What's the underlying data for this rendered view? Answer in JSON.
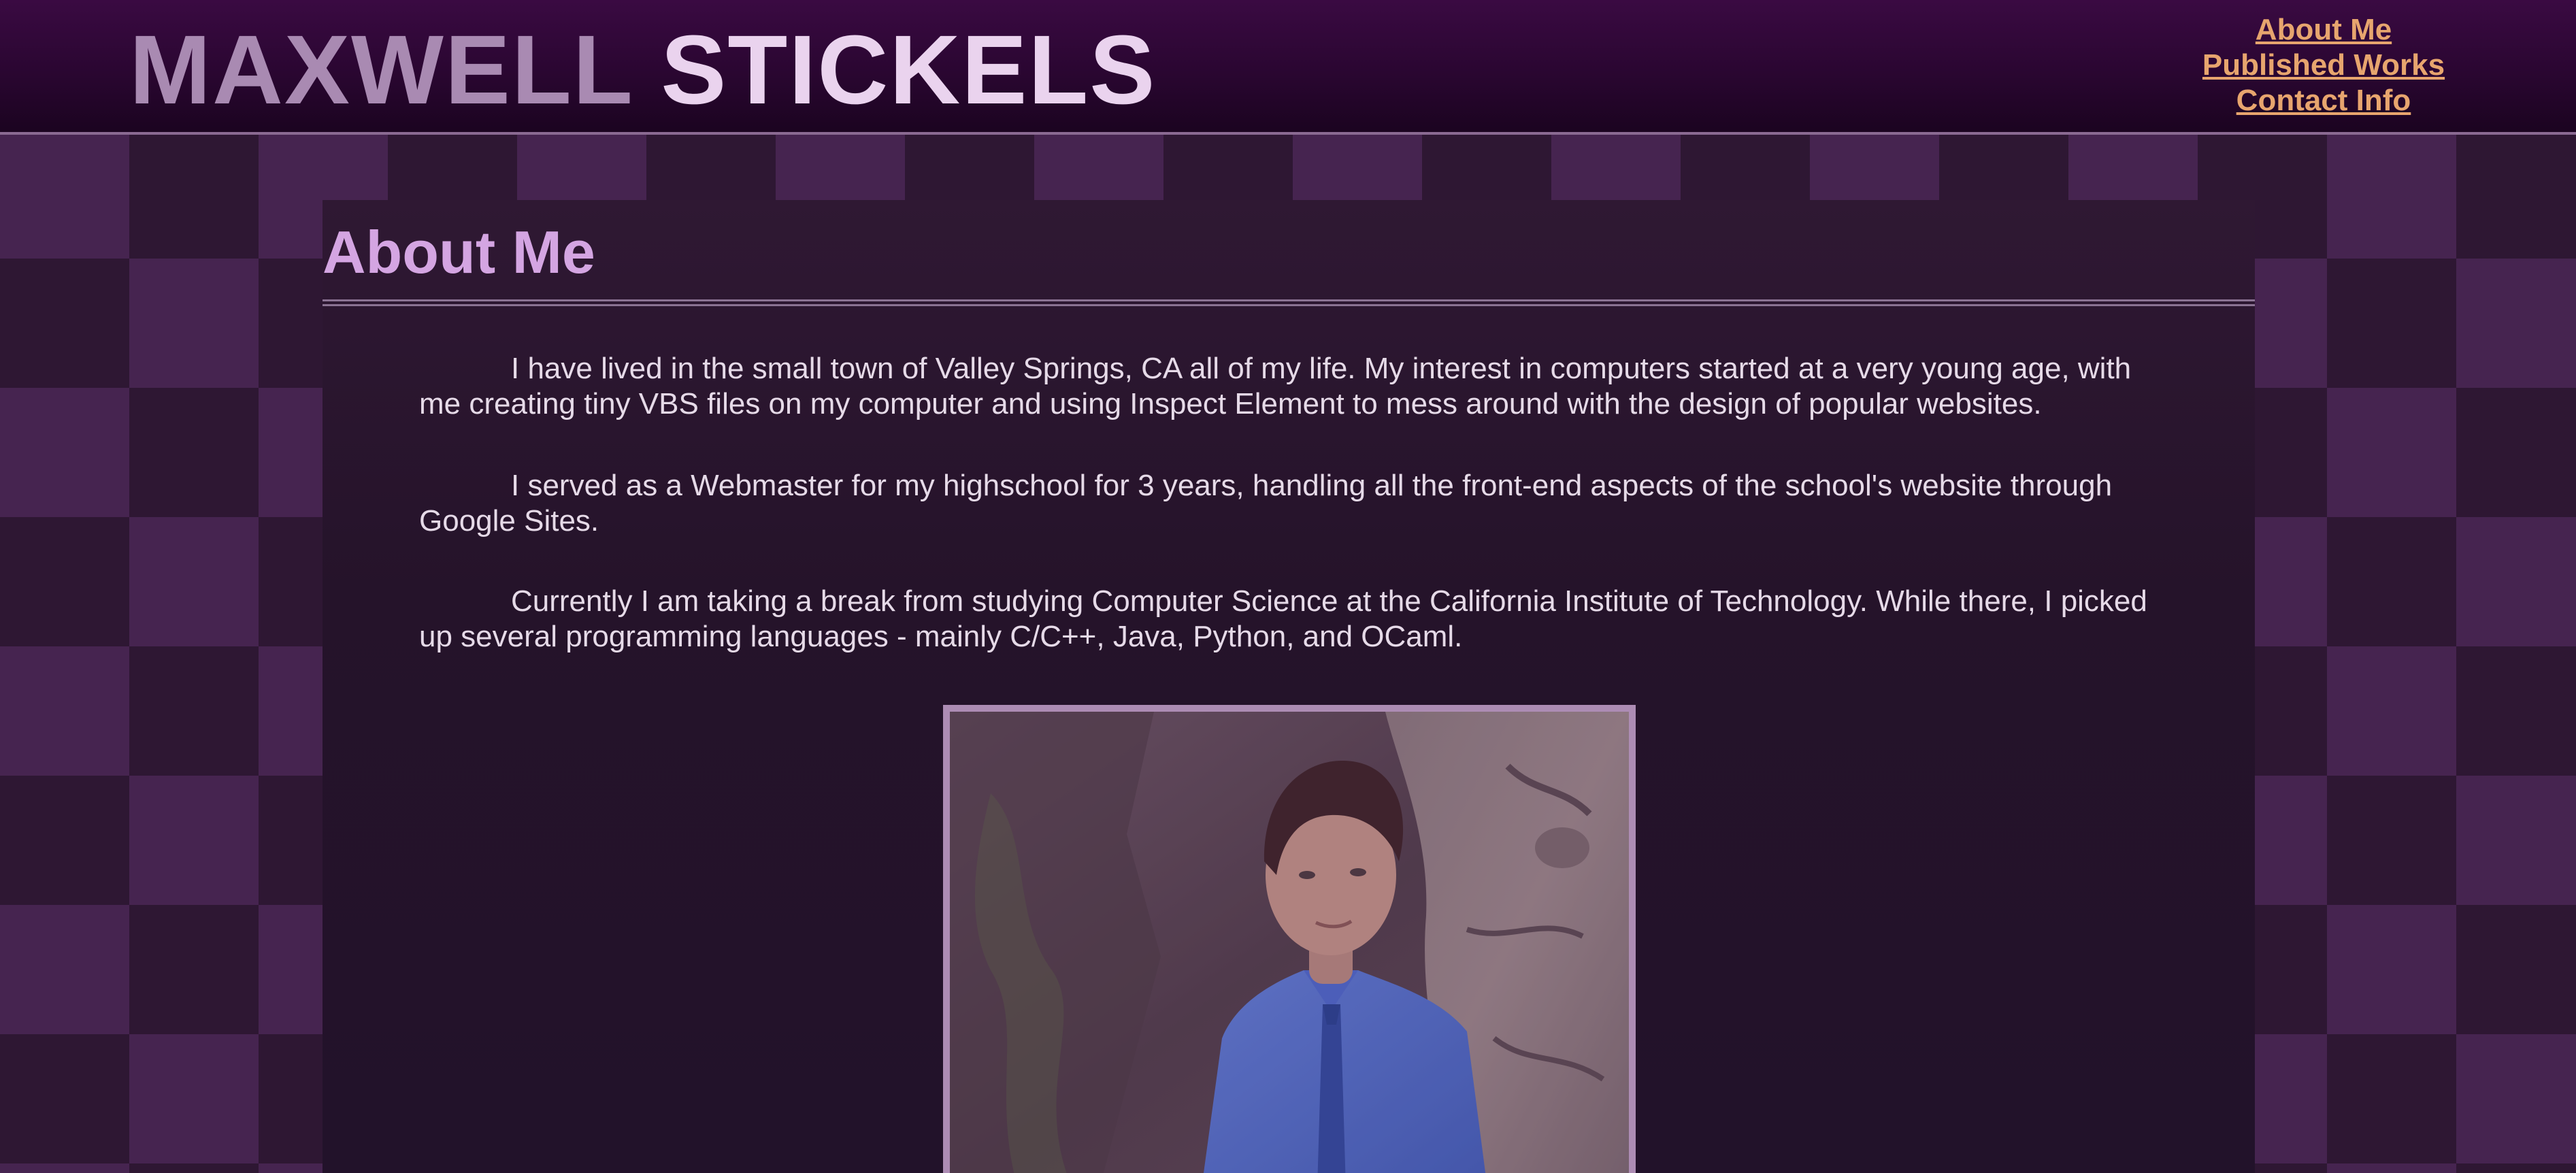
{
  "header": {
    "title_first": "MAXWELL",
    "title_last": "STICKELS",
    "nav": [
      {
        "label": "About Me"
      },
      {
        "label": "Published Works"
      },
      {
        "label": "Contact Info"
      }
    ]
  },
  "main": {
    "heading": "About Me",
    "paragraphs": [
      "I have lived in the small town of Valley Springs, CA all of my life. My interest in computers started at a very young age, with me creating tiny VBS files on my computer and using Inspect Element to mess around with the design of popular websites.",
      "I served as a Webmaster for my highschool for 3 years, handling all the front-end aspects of the school's website through Google Sites.",
      "Currently I am taking a break from studying Computer Science at the California Institute of Technology. While there, I picked up several programming languages - mainly C/C++, Java, Python, and OCaml."
    ]
  },
  "colors": {
    "header_bg": "#2a0631",
    "title_first": "#a98ab2",
    "title_last": "#ead3ee",
    "nav_link": "#e7a56e",
    "heading": "#d4a5e2",
    "body_text": "#e6dae8",
    "panel_bg": "#25132a",
    "pattern_dark": "#2e1733",
    "pattern_light": "#462450"
  }
}
